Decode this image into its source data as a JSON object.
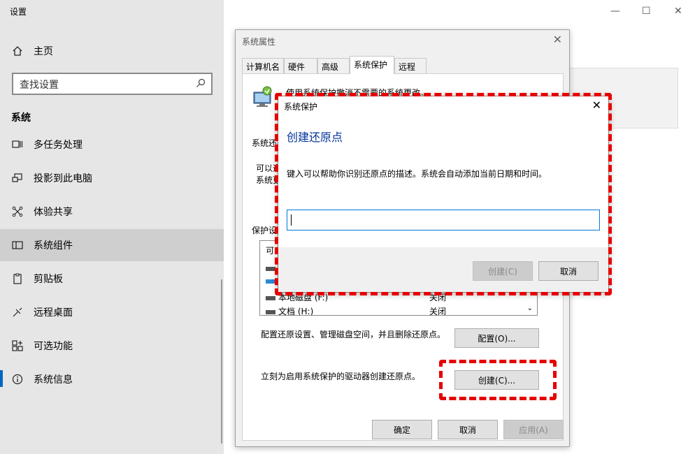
{
  "app": {
    "title": "设置",
    "minimize": "—",
    "maximize": "☐",
    "close": "✕"
  },
  "sidebar": {
    "home": "主页",
    "search_placeholder": "查找设置",
    "section": "系统",
    "items": [
      {
        "label": "多任务处理",
        "icon": "multitask-icon"
      },
      {
        "label": "投影到此电脑",
        "icon": "project-icon"
      },
      {
        "label": "体验共享",
        "icon": "share-icon"
      },
      {
        "label": "系统组件",
        "icon": "components-icon",
        "selected": true
      },
      {
        "label": "剪贴板",
        "icon": "clipboard-icon"
      },
      {
        "label": "远程桌面",
        "icon": "remote-desktop-icon"
      },
      {
        "label": "可选功能",
        "icon": "optional-features-icon"
      },
      {
        "label": "系统信息",
        "icon": "info-icon"
      }
    ]
  },
  "sysprop": {
    "title": "系统属性",
    "tabs": [
      "计算机名",
      "硬件",
      "高级",
      "系统保护",
      "远程"
    ],
    "active_tab": "系统保护",
    "top_text": "使用系统保护撤消不需要的系统更改。",
    "restore_label": "系统还",
    "restore_text1": "可以通",
    "restore_text2": "系统更",
    "protect_label": "保护设",
    "list_header": "可",
    "drives": [
      {
        "name": "本地磁盘 (F:)",
        "status": "关闭"
      },
      {
        "name": "文档 (H:)",
        "status": "关闭"
      }
    ],
    "config_text": "配置还原设置、管理磁盘空间，并且删除还原点。",
    "config_button": "配置(O)...",
    "create_text": "立刻为启用系统保护的驱动器创建还原点。",
    "create_button": "创建(C)...",
    "ok_button": "确定",
    "cancel_button": "取消",
    "apply_button": "应用(A)"
  },
  "dialog": {
    "title": "系统保护",
    "heading": "创建还原点",
    "description": "键入可以帮助你识别还原点的描述。系统会自动添加当前日期和时间。",
    "input_value": "",
    "create_button": "创建(C)",
    "cancel_button": "取消"
  }
}
